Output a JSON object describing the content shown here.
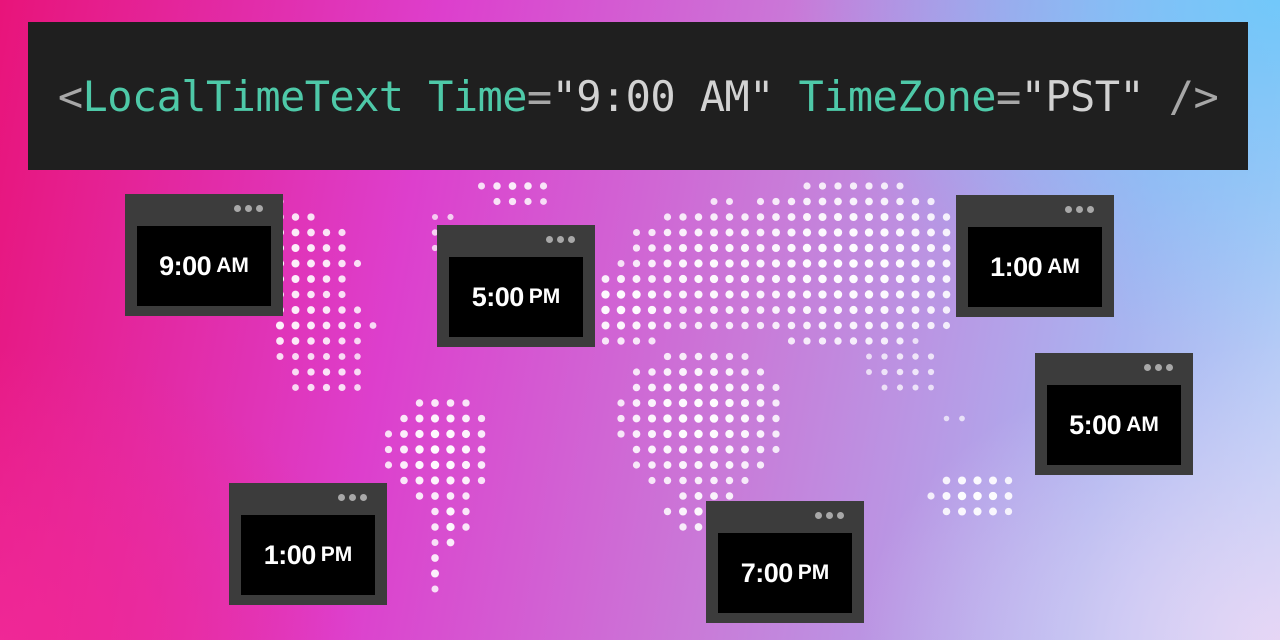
{
  "code_snippet": {
    "open": "<",
    "tag": "LocalTimeText",
    "attr1_name": "Time",
    "attr1_eq": "=",
    "attr1_value": "\"9:00 AM\"",
    "attr2_name": "TimeZone",
    "attr2_eq": "=",
    "attr2_value": "\"PST\"",
    "close": "/>"
  },
  "clocks": [
    {
      "time": "9:00",
      "period": "AM"
    },
    {
      "time": "5:00",
      "period": "PM"
    },
    {
      "time": "1:00",
      "period": "AM"
    },
    {
      "time": "5:00",
      "period": "AM"
    },
    {
      "time": "1:00",
      "period": "PM"
    },
    {
      "time": "7:00",
      "period": "PM"
    }
  ],
  "colors": {
    "banner_background": "#1f1f1f",
    "code_tag": "#4ec9a8",
    "code_string": "#d2d2d2",
    "code_punctuation": "#a7a7a7",
    "window_frame": "#3c3c3c",
    "window_screen": "#000000",
    "map_dots": "#ffffff"
  }
}
